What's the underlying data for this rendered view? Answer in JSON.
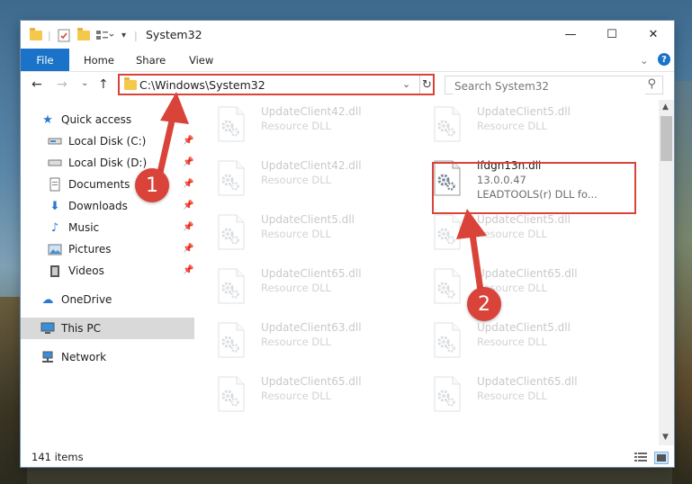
{
  "window": {
    "title": "System32",
    "minimize": "—",
    "maximize": "☐",
    "close": "✕"
  },
  "ribbon": {
    "tabs": [
      "File",
      "Home",
      "Share",
      "View"
    ],
    "expand_chevron": "⌄",
    "help": "?"
  },
  "nav": {
    "back": "←",
    "forward": "→",
    "recent": "⌄",
    "up": "↑",
    "address": "C:\\Windows\\System32",
    "search_placeholder": "Search System32"
  },
  "sidebar": {
    "items": [
      {
        "label": "Quick access",
        "icon": "star-icon",
        "pinned": false
      },
      {
        "label": "Local Disk (C:)",
        "icon": "drive-icon",
        "pinned": true
      },
      {
        "label": "Local Disk (D:)",
        "icon": "drive-icon",
        "pinned": true
      },
      {
        "label": "Documents",
        "icon": "documents-icon",
        "pinned": true
      },
      {
        "label": "Downloads",
        "icon": "downloads-icon",
        "pinned": true
      },
      {
        "label": "Music",
        "icon": "music-icon",
        "pinned": true
      },
      {
        "label": "Pictures",
        "icon": "pictures-icon",
        "pinned": true
      },
      {
        "label": "Videos",
        "icon": "videos-icon",
        "pinned": true
      },
      {
        "label": "OneDrive",
        "icon": "cloud-icon",
        "pinned": false
      },
      {
        "label": "This PC",
        "icon": "computer-icon",
        "pinned": false,
        "selected": true
      },
      {
        "label": "Network",
        "icon": "network-icon",
        "pinned": false
      }
    ]
  },
  "files": {
    "col1": [
      {
        "name": "UpdateClient42.dll",
        "type": "Resource DLL"
      },
      {
        "name": "UpdateClient42.dll",
        "type": "Resource DLL"
      },
      {
        "name": "UpdateClient5.dll",
        "type": "Resource DLL"
      },
      {
        "name": "UpdateClient65.dll",
        "type": "Resource DLL"
      },
      {
        "name": "UpdateClient63.dll",
        "type": "Resource DLL"
      },
      {
        "name": "UpdateClient65.dll",
        "type": "Resource DLL"
      }
    ],
    "col2": [
      {
        "name": "UpdateClient5.dll",
        "type": "Resource DLL"
      },
      {
        "name": "lfdgn13n.dll",
        "version": "13.0.0.47",
        "description": "LEADTOOLS(r) DLL fo...",
        "highlighted": true
      },
      {
        "name": "UpdateClient5.dll",
        "type": "Resource DLL"
      },
      {
        "name": "UpdateClient65.dll",
        "type": "Resource DLL"
      },
      {
        "name": "UpdateClient5.dll",
        "type": "Resource DLL"
      },
      {
        "name": "UpdateClient65.dll",
        "type": "Resource DLL"
      }
    ]
  },
  "status": {
    "item_count": "141 items"
  },
  "annotations": {
    "step1": "1",
    "step2": "2",
    "color": "#d9433a"
  }
}
